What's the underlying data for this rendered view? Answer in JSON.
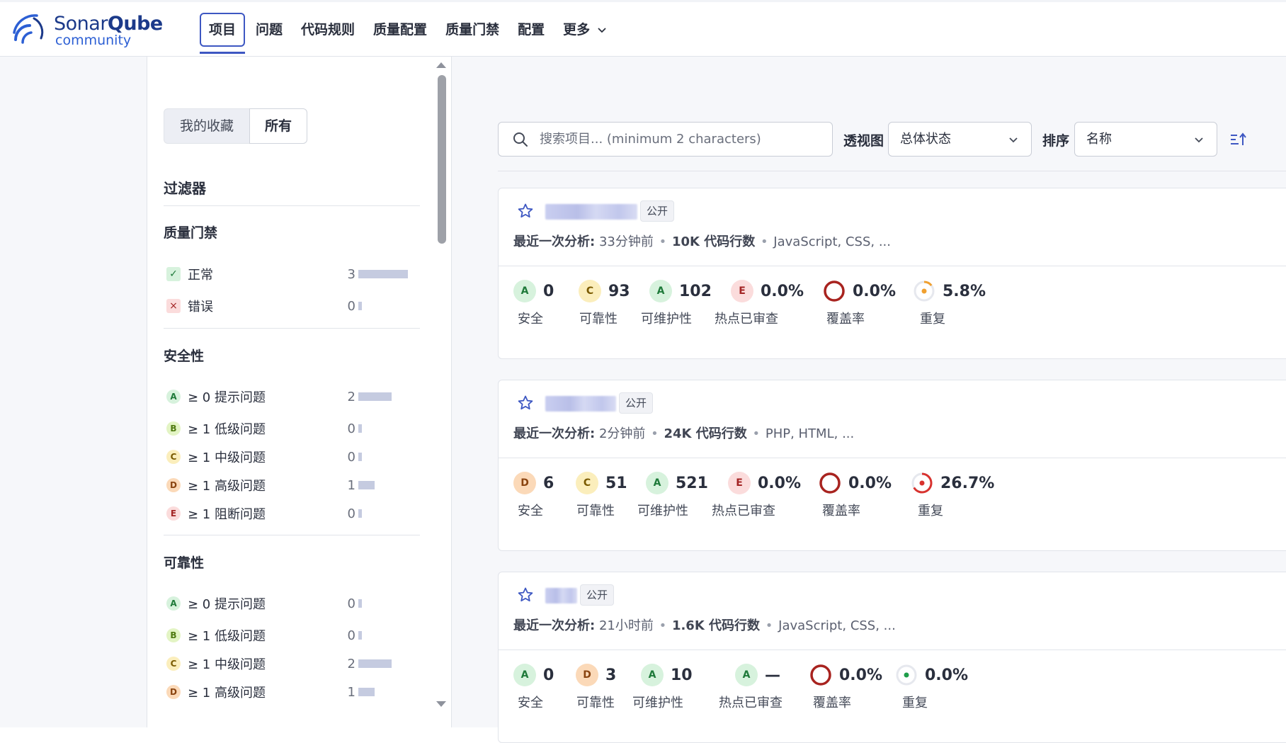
{
  "brand": {
    "name_a": "Sonar",
    "name_b": "Qube",
    "sub": "community"
  },
  "nav": {
    "items": [
      "项目",
      "问题",
      "代码规则",
      "质量配置",
      "质量门禁",
      "配置"
    ],
    "more": "更多"
  },
  "sidebar": {
    "toggle": {
      "favorites": "我的收藏",
      "all": "所有"
    },
    "filters_title": "过滤器",
    "quality_gate": {
      "title": "质量门禁",
      "items": [
        {
          "label": "正常",
          "count": "3",
          "share": 1.0
        },
        {
          "label": "错误",
          "count": "0",
          "share": 0.0
        }
      ]
    },
    "security": {
      "title": "安全性",
      "items": [
        {
          "rating": "A",
          "label": "≥ 0 提示问题",
          "count": "2",
          "share": 0.67
        },
        {
          "rating": "B",
          "label": "≥ 1 低级问题",
          "count": "0",
          "share": 0.0
        },
        {
          "rating": "C",
          "label": "≥ 1 中级问题",
          "count": "0",
          "share": 0.0
        },
        {
          "rating": "D",
          "label": "≥ 1 高级问题",
          "count": "1",
          "share": 0.33
        },
        {
          "rating": "E",
          "label": "≥ 1 阻断问题",
          "count": "0",
          "share": 0.0
        }
      ]
    },
    "reliability": {
      "title": "可靠性",
      "items": [
        {
          "rating": "A",
          "label": "≥ 0 提示问题",
          "count": "0",
          "share": 0.0
        },
        {
          "rating": "B",
          "label": "≥ 1 低级问题",
          "count": "0",
          "share": 0.0
        },
        {
          "rating": "C",
          "label": "≥ 1 中级问题",
          "count": "2",
          "share": 0.67
        },
        {
          "rating": "D",
          "label": "≥ 1 高级问题",
          "count": "1",
          "share": 0.33
        }
      ]
    }
  },
  "toolbar": {
    "search_placeholder": "搜索项目... (minimum 2 characters)",
    "perspective_label": "透视图",
    "perspective_value": "总体状态",
    "sort_label": "排序",
    "sort_value": "名称"
  },
  "metric_labels": {
    "security": "安全",
    "reliability": "可靠性",
    "maintainability": "可维护性",
    "hotspots": "热点已审查",
    "coverage": "覆盖率",
    "duplication": "重复"
  },
  "projects": [
    {
      "visibility": "公开",
      "analysis_label": "最近一次分析:",
      "analysis_time": "33分钟前",
      "loc": "10K 代码行数",
      "languages": "JavaScript, CSS, ...",
      "security": {
        "rating": "A",
        "value": "0"
      },
      "reliability": {
        "rating": "C",
        "value": "93"
      },
      "maintainability": {
        "rating": "A",
        "value": "102"
      },
      "hotspots": {
        "rating": "E",
        "value": "0.0%"
      },
      "coverage": {
        "value": "0.0%"
      },
      "duplication": {
        "value": "5.8%",
        "color": "#f0a030"
      }
    },
    {
      "visibility": "公开",
      "analysis_label": "最近一次分析:",
      "analysis_time": "2分钟前",
      "loc": "24K 代码行数",
      "languages": "PHP, HTML, ...",
      "security": {
        "rating": "D",
        "value": "6"
      },
      "reliability": {
        "rating": "C",
        "value": "51"
      },
      "maintainability": {
        "rating": "A",
        "value": "521"
      },
      "hotspots": {
        "rating": "E",
        "value": "0.0%"
      },
      "coverage": {
        "value": "0.0%"
      },
      "duplication": {
        "value": "26.7%",
        "color": "#d8322e"
      }
    },
    {
      "visibility": "公开",
      "analysis_label": "最近一次分析:",
      "analysis_time": "21小时前",
      "loc": "1.6K 代码行数",
      "languages": "JavaScript, CSS, ...",
      "security": {
        "rating": "A",
        "value": "0"
      },
      "reliability": {
        "rating": "D",
        "value": "3"
      },
      "maintainability": {
        "rating": "A",
        "value": "10"
      },
      "hotspots": {
        "rating": "A",
        "value": "—"
      },
      "coverage": {
        "value": "0.0%"
      },
      "duplication": {
        "value": "0.0%",
        "color": "#1f9e4a"
      }
    }
  ]
}
